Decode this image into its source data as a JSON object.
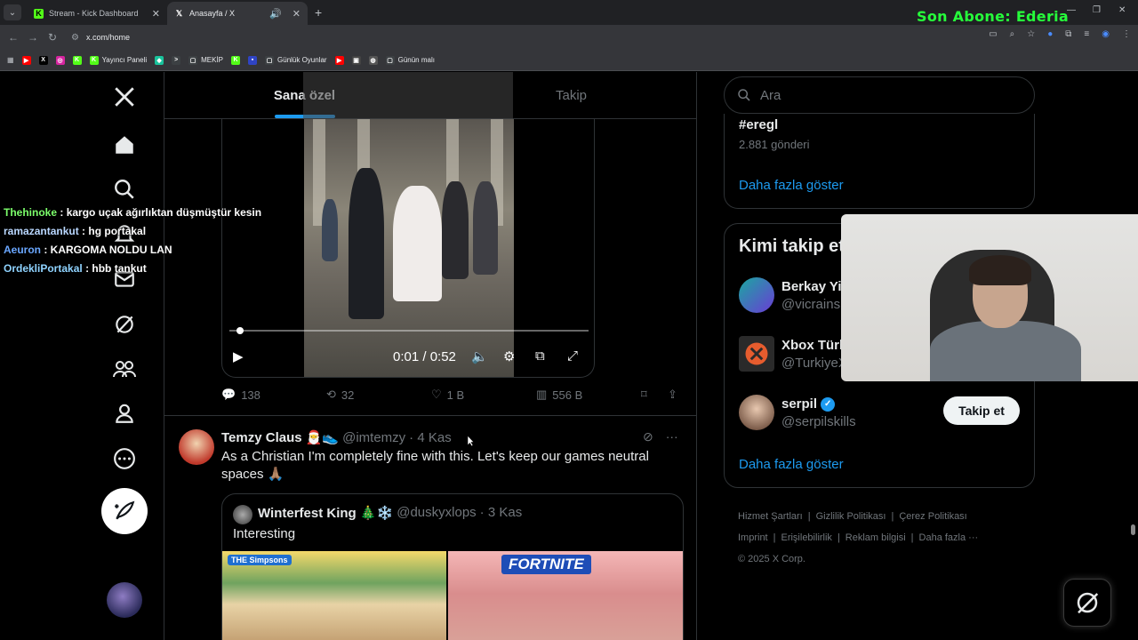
{
  "browser": {
    "tabs": [
      {
        "title": "Stream - Kick Dashboard",
        "favicon": "kick-icon",
        "color": "#53fc18",
        "active": false
      },
      {
        "title": "Anasayfa / X",
        "favicon": "x-icon",
        "color": "#ffffff",
        "active": true
      }
    ],
    "url": "x.com/home",
    "overlay_text": "Son Abone: Ederia",
    "bookmarks": [
      {
        "label": "",
        "icon": "youtube-icon",
        "color": "#ff0000"
      },
      {
        "label": "",
        "icon": "x-icon",
        "color": "#000000"
      },
      {
        "label": "",
        "icon": "instagram-icon",
        "color": "#d6249f"
      },
      {
        "label": "",
        "icon": "kick-icon",
        "color": "#53fc18"
      },
      {
        "label": "Yayıncı Paneli",
        "icon": "kick-icon",
        "color": "#53fc18"
      },
      {
        "label": "",
        "icon": "chat-icon",
        "color": "#19c39c"
      },
      {
        "label": "",
        "icon": "arrow-icon",
        "color": "#3c4043"
      },
      {
        "label": "MEKİP",
        "icon": "folder-icon",
        "color": "#3c4043"
      },
      {
        "label": "",
        "icon": "kick-icon",
        "color": "#53fc18"
      },
      {
        "label": "",
        "icon": "app-icon",
        "color": "#2f44c4"
      },
      {
        "label": "Günlük Oyunlar",
        "icon": "folder-icon",
        "color": "#3c4043"
      },
      {
        "label": "",
        "icon": "youtube-icon",
        "color": "#ff0000"
      },
      {
        "label": "",
        "icon": "image-icon",
        "color": "#444444"
      },
      {
        "label": "",
        "icon": "globe-icon",
        "color": "#555555"
      },
      {
        "label": "Günün malı",
        "icon": "folder-icon",
        "color": "#3c4043"
      }
    ]
  },
  "feed_tabs": {
    "for_you": "Sana özel",
    "following": "Takip"
  },
  "video": {
    "time": "0:01 / 0:52",
    "progress": 0.02
  },
  "tweet1_actions": {
    "replies": "138",
    "reposts": "32",
    "likes": "1 B",
    "views": "556 B"
  },
  "tweet2": {
    "name": "Temzy Claus 🎅👟",
    "handle": "@imtemzy",
    "time": "· 4 Kas",
    "text": "As a Christian I'm completely fine with this. Let's keep our games neutral spaces 🙏🏽",
    "quote": {
      "name": "Winterfest King 🎄❄️",
      "handle": "@duskyxlops",
      "time": "· 3 Kas",
      "text": "Interesting",
      "left_label": "THE Simpsons",
      "right_label": "FORTNITE"
    }
  },
  "sidebar": {
    "search_placeholder": "Ara",
    "trend": {
      "tag": "#eregl",
      "posts": "2.881 gönderi",
      "more": "Daha fazla göster"
    },
    "who_to_follow": {
      "title": "Kimi takip et",
      "users": [
        {
          "name": "Berkay Yi",
          "handle": "@vicrains"
        },
        {
          "name": "Xbox Türk",
          "handle": "@TurkiyeX"
        },
        {
          "name": "serpil",
          "handle": "@serpilskills",
          "follow": "Takip et"
        }
      ],
      "more": "Daha fazla göster"
    },
    "footer": [
      "Hizmet Şartları",
      "Gizlilik Politikası",
      "Çerez Politikası",
      "Imprint",
      "Erişilebilirlik",
      "Reklam bilgisi",
      "Daha fazla ···",
      "© 2025 X Corp."
    ]
  },
  "chat": [
    {
      "user": "Thehinoke",
      "msg": ": kargo uçak ağırlıktan düşmüştür kesin"
    },
    {
      "user": "ramazantankut",
      "msg": ": hg portakal"
    },
    {
      "user": "Aeuron",
      "msg": ": KARGOMA NOLDU LAN"
    },
    {
      "user": "OrdekliPortakal",
      "msg": ": hbb tankut"
    }
  ]
}
